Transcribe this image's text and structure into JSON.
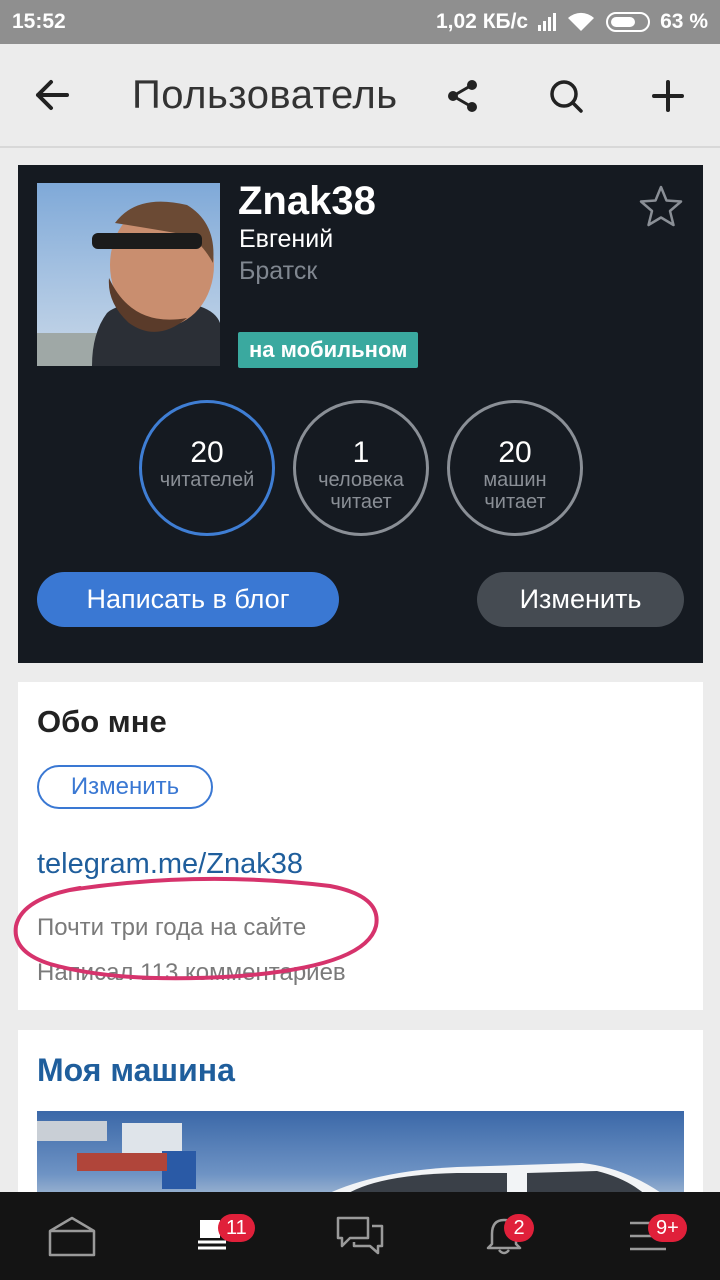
{
  "status_bar": {
    "time": "15:52",
    "speed": "1,02 КБ/с",
    "battery": "63 %"
  },
  "app_bar": {
    "title": "Пользователь",
    "icons": [
      "back-arrow-icon",
      "share-icon",
      "search-icon",
      "plus-icon"
    ]
  },
  "profile": {
    "nickname": "Znak38",
    "first_name": "Евгений",
    "city": "Братск",
    "status_badge": "на мобильном",
    "stats": [
      {
        "num": "20",
        "label": "читателей"
      },
      {
        "num": "1",
        "label": "человека читает"
      },
      {
        "num": "20",
        "label": "машин читает"
      }
    ],
    "write_button": "Написать в блог",
    "edit_button": "Изменить"
  },
  "about": {
    "heading": "Обо мне",
    "edit_button": "Изменить",
    "link": "telegram.me/Znak38",
    "years_on_site": "Почти три года на сайте",
    "comments": "Написал 113 комментариев"
  },
  "car": {
    "heading": "Моя машина"
  },
  "bottom_nav": {
    "items": [
      {
        "icon": "home-icon",
        "badge": ""
      },
      {
        "icon": "feed-icon",
        "badge": "11"
      },
      {
        "icon": "messages-icon",
        "badge": ""
      },
      {
        "icon": "bell-icon",
        "badge": "2"
      },
      {
        "icon": "menu-icon",
        "badge": "9+"
      }
    ]
  },
  "colors": {
    "accent": "#3a78d3",
    "card_dark": "#151a21",
    "badge_green": "#3aa99f",
    "badge_red": "#e0203a",
    "highlight": "#d6336c"
  }
}
